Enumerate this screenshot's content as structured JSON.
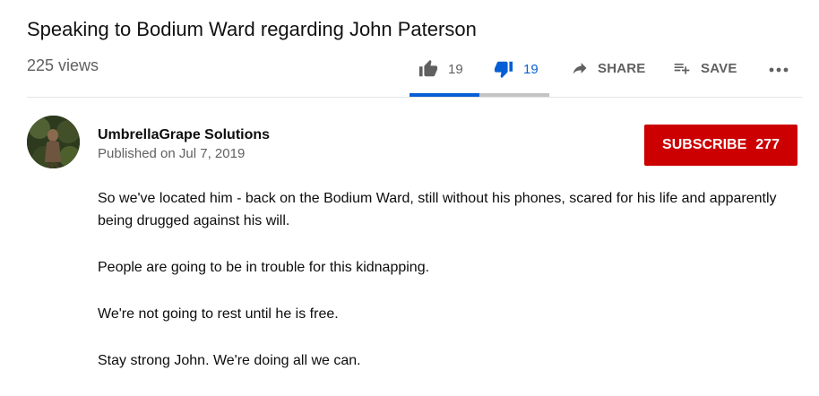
{
  "video": {
    "title": "Speaking to Bodium Ward regarding John Paterson",
    "views": "225 views"
  },
  "actions": {
    "likes": "19",
    "dislikes": "19",
    "share_label": "SHARE",
    "save_label": "SAVE",
    "like_fraction": 0.5,
    "colors": {
      "active": "#065fd4",
      "inactive": "#606060",
      "bar_bg": "#c4c4c4"
    },
    "icons": [
      "thumbs-up-icon",
      "thumbs-down-icon",
      "share-arrow-icon",
      "playlist-add-icon",
      "more-horizontal-icon"
    ]
  },
  "channel": {
    "name": "UmbrellaGrape Solutions",
    "published": "Published on Jul 7, 2019"
  },
  "subscribe": {
    "label": "SUBSCRIBE",
    "count": "277",
    "color": "#cc0000"
  },
  "description": {
    "paragraphs": [
      "So we've located him - back on the Bodium Ward, still without his phones, scared for his life and apparently being drugged against his will.",
      "People are going to be in trouble for this kidnapping.",
      "We're not going to rest until he is free.",
      "Stay strong John.  We're doing all we can."
    ]
  }
}
